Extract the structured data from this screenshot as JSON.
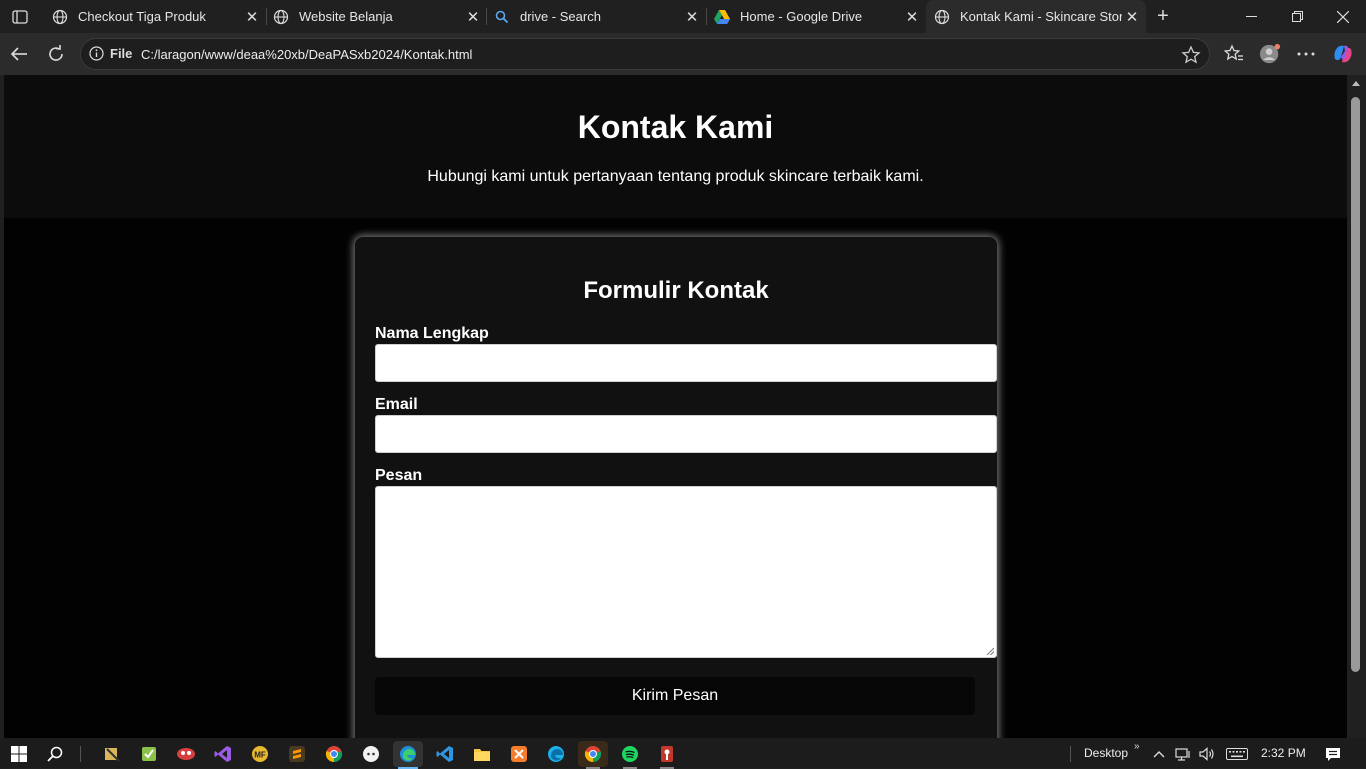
{
  "browser": {
    "tabs": [
      {
        "label": "Checkout Tiga Produk",
        "icon": "globe-icon",
        "active": false
      },
      {
        "label": "Website Belanja",
        "icon": "globe-icon",
        "active": false
      },
      {
        "label": "drive - Search",
        "icon": "search-icon",
        "active": false
      },
      {
        "label": "Home - Google Drive",
        "icon": "google-drive-icon",
        "active": false
      },
      {
        "label": "Kontak Kami - Skincare Store",
        "icon": "globe-icon",
        "active": true
      }
    ],
    "address": {
      "scheme_label": "File",
      "url": "C:/laragon/www/deaa%20xb/DeaPASxb2024/Kontak.html"
    }
  },
  "page": {
    "header": {
      "title": "Kontak Kami",
      "subtitle": "Hubungi kami untuk pertanyaan tentang produk skincare terbaik kami."
    },
    "form": {
      "title": "Formulir Kontak",
      "name_label": "Nama Lengkap",
      "name_value": "",
      "email_label": "Email",
      "email_value": "",
      "message_label": "Pesan",
      "message_value": "",
      "submit_label": "Kirim Pesan"
    }
  },
  "taskbar": {
    "desktop_label": "Desktop",
    "clock": "2:32 PM"
  },
  "colors": {
    "page_bg": "#020202",
    "header_bg": "#0c0c0c",
    "card_bg": "#111111",
    "active_indicator": "#6cb8f6"
  }
}
